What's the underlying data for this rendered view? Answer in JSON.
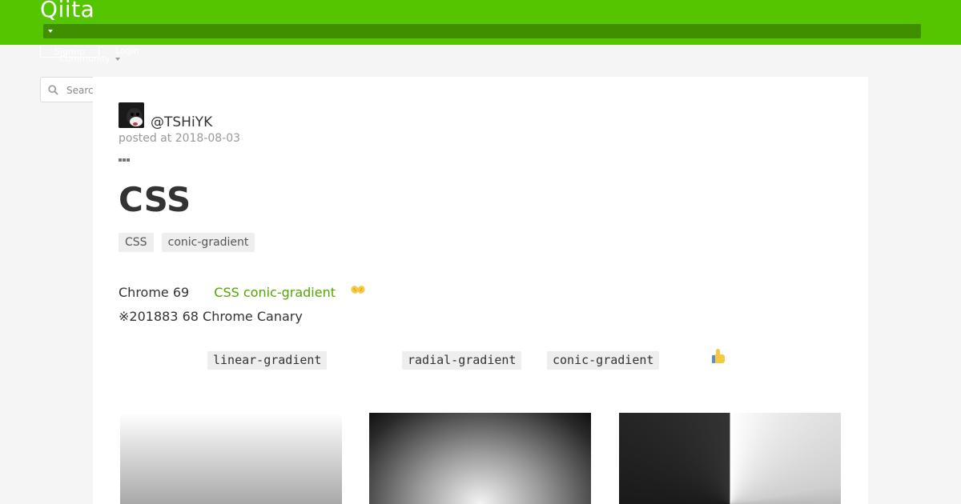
{
  "header": {
    "logo": "Qiita",
    "signup_label": "Signup",
    "login_label": "Login",
    "community_label": "Community"
  },
  "search": {
    "placeholder": "Search"
  },
  "article": {
    "author": "@TSHiYK",
    "posted": "posted at 2018-08-03",
    "title": "CSS",
    "tags": [
      "CSS",
      "conic-gradient"
    ],
    "line1_prefix": "Chrome 69",
    "line1_link": "CSS conic-gradient",
    "line2": "※201883 68  Chrome Canary",
    "codes": [
      "linear-gradient",
      "radial-gradient",
      "conic-gradient"
    ]
  },
  "colors": {
    "brand": "#55c500",
    "link": "#52a600"
  },
  "icons": [
    "caret-down-icon",
    "search-icon",
    "more-icon",
    "clap-emoji-icon",
    "thumbs-up-emoji-icon"
  ]
}
